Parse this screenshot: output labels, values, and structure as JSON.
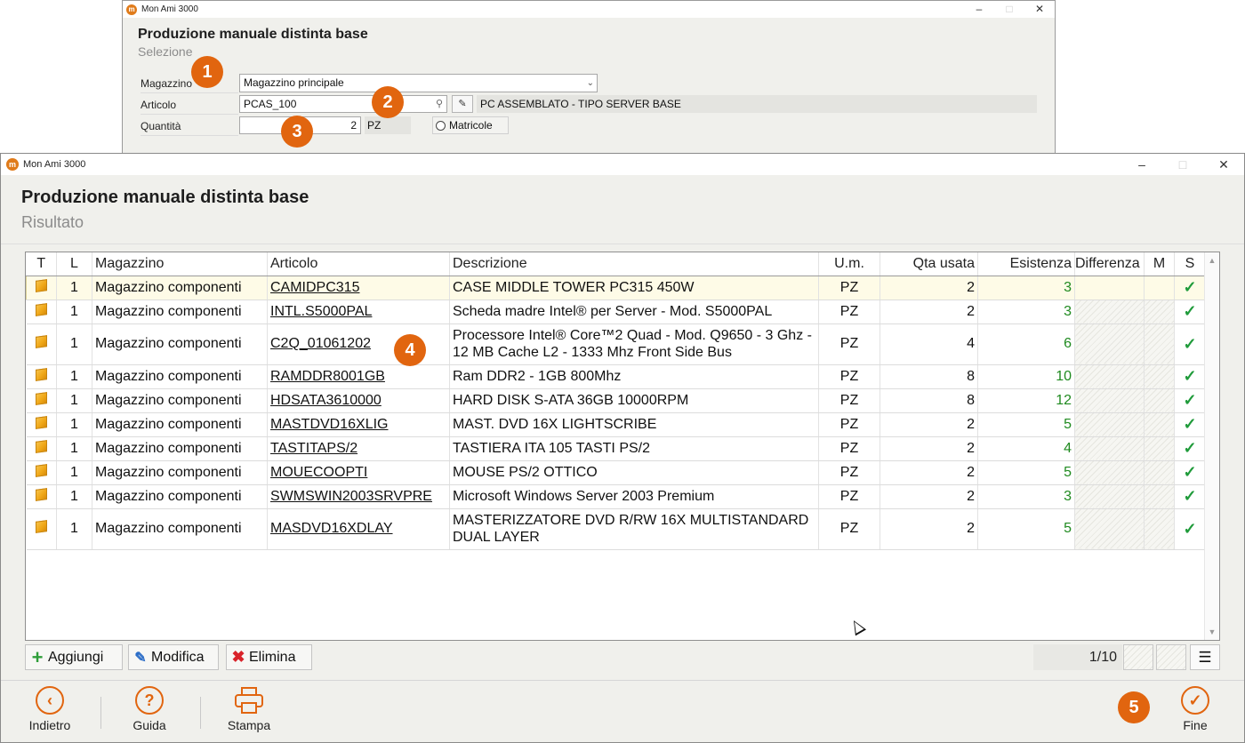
{
  "back_window": {
    "title": "Mon Ami 3000",
    "heading": "Produzione manuale distinta base",
    "subheading": "Selezione",
    "magazzino_label": "Magazzino",
    "magazzino_value": "Magazzino principale",
    "articolo_label": "Articolo",
    "articolo_value": "PCAS_100",
    "articolo_desc": "PC ASSEMBLATO - TIPO SERVER BASE",
    "quantita_label": "Quantità",
    "quantita_value": "2",
    "um": "PZ",
    "matricole_label": "Matricole"
  },
  "front_window": {
    "title": "Mon Ami 3000",
    "heading": "Produzione manuale distinta base",
    "subheading": "Risultato"
  },
  "grid": {
    "headers": [
      "T",
      "L",
      "Magazzino",
      "Articolo",
      "Descrizione",
      "U.m.",
      "Qta usata",
      "Esistenza",
      "Differenza",
      "M",
      "S"
    ],
    "rows": [
      {
        "l": "1",
        "magazzino": "Magazzino componenti",
        "articolo": "CAMIDPC315",
        "descrizione": "CASE MIDDLE TOWER PC315 450W",
        "um": "PZ",
        "qta": "2",
        "esistenza": "3"
      },
      {
        "l": "1",
        "magazzino": "Magazzino componenti",
        "articolo": "INTL.S5000PAL",
        "descrizione": "Scheda madre Intel® per Server - Mod. S5000PAL",
        "um": "PZ",
        "qta": "2",
        "esistenza": "3"
      },
      {
        "l": "1",
        "magazzino": "Magazzino componenti",
        "articolo": "C2Q_01061202",
        "descrizione": "Processore Intel® Core™2 Quad - Mod. Q9650 - 3 Ghz - 12 MB Cache L2 - 1333 Mhz Front Side Bus",
        "um": "PZ",
        "qta": "4",
        "esistenza": "6"
      },
      {
        "l": "1",
        "magazzino": "Magazzino componenti",
        "articolo": "RAMDDR8001GB",
        "descrizione": "Ram DDR2 - 1GB 800Mhz",
        "um": "PZ",
        "qta": "8",
        "esistenza": "10"
      },
      {
        "l": "1",
        "magazzino": "Magazzino componenti",
        "articolo": "HDSATA3610000",
        "descrizione": "HARD DISK S-ATA 36GB 10000RPM",
        "um": "PZ",
        "qta": "8",
        "esistenza": "12"
      },
      {
        "l": "1",
        "magazzino": "Magazzino componenti",
        "articolo": "MASTDVD16XLIG",
        "descrizione": "MAST.  DVD 16X  LIGHTSCRIBE",
        "um": "PZ",
        "qta": "2",
        "esistenza": "5"
      },
      {
        "l": "1",
        "magazzino": "Magazzino componenti",
        "articolo": "TASTITAPS/2",
        "descrizione": "TASTIERA ITA 105 TASTI PS/2",
        "um": "PZ",
        "qta": "2",
        "esistenza": "4"
      },
      {
        "l": "1",
        "magazzino": "Magazzino componenti",
        "articolo": "MOUECOOPTI",
        "descrizione": "MOUSE PS/2 OTTICO",
        "um": "PZ",
        "qta": "2",
        "esistenza": "5"
      },
      {
        "l": "1",
        "magazzino": "Magazzino componenti",
        "articolo": "SWMSWIN2003SRVPRE",
        "descrizione": "Microsoft Windows Server 2003 Premium",
        "um": "PZ",
        "qta": "2",
        "esistenza": "3"
      },
      {
        "l": "1",
        "magazzino": "Magazzino componenti",
        "articolo": "MASDVD16XDLAY",
        "descrizione": "MASTERIZZATORE DVD R/RW 16X MULTISTANDARD DUAL LAYER",
        "um": "PZ",
        "qta": "2",
        "esistenza": "5"
      }
    ]
  },
  "toolbar": {
    "add_label": "Aggiungi",
    "edit_label": "Modifica",
    "delete_label": "Elimina",
    "pager": "1/10"
  },
  "footer": {
    "back_label": "Indietro",
    "help_label": "Guida",
    "print_label": "Stampa",
    "finish_label": "Fine"
  },
  "badges": [
    "1",
    "2",
    "3",
    "4",
    "5"
  ],
  "colors": {
    "accent": "#e1650f",
    "quantity_ok": "#1f8a1f",
    "selected_row": "#fefbe7"
  },
  "icons": {
    "row_type": "box-icon",
    "status": "check-icon",
    "add": "plus-icon",
    "edit": "edit-icon",
    "delete": "x-icon"
  }
}
